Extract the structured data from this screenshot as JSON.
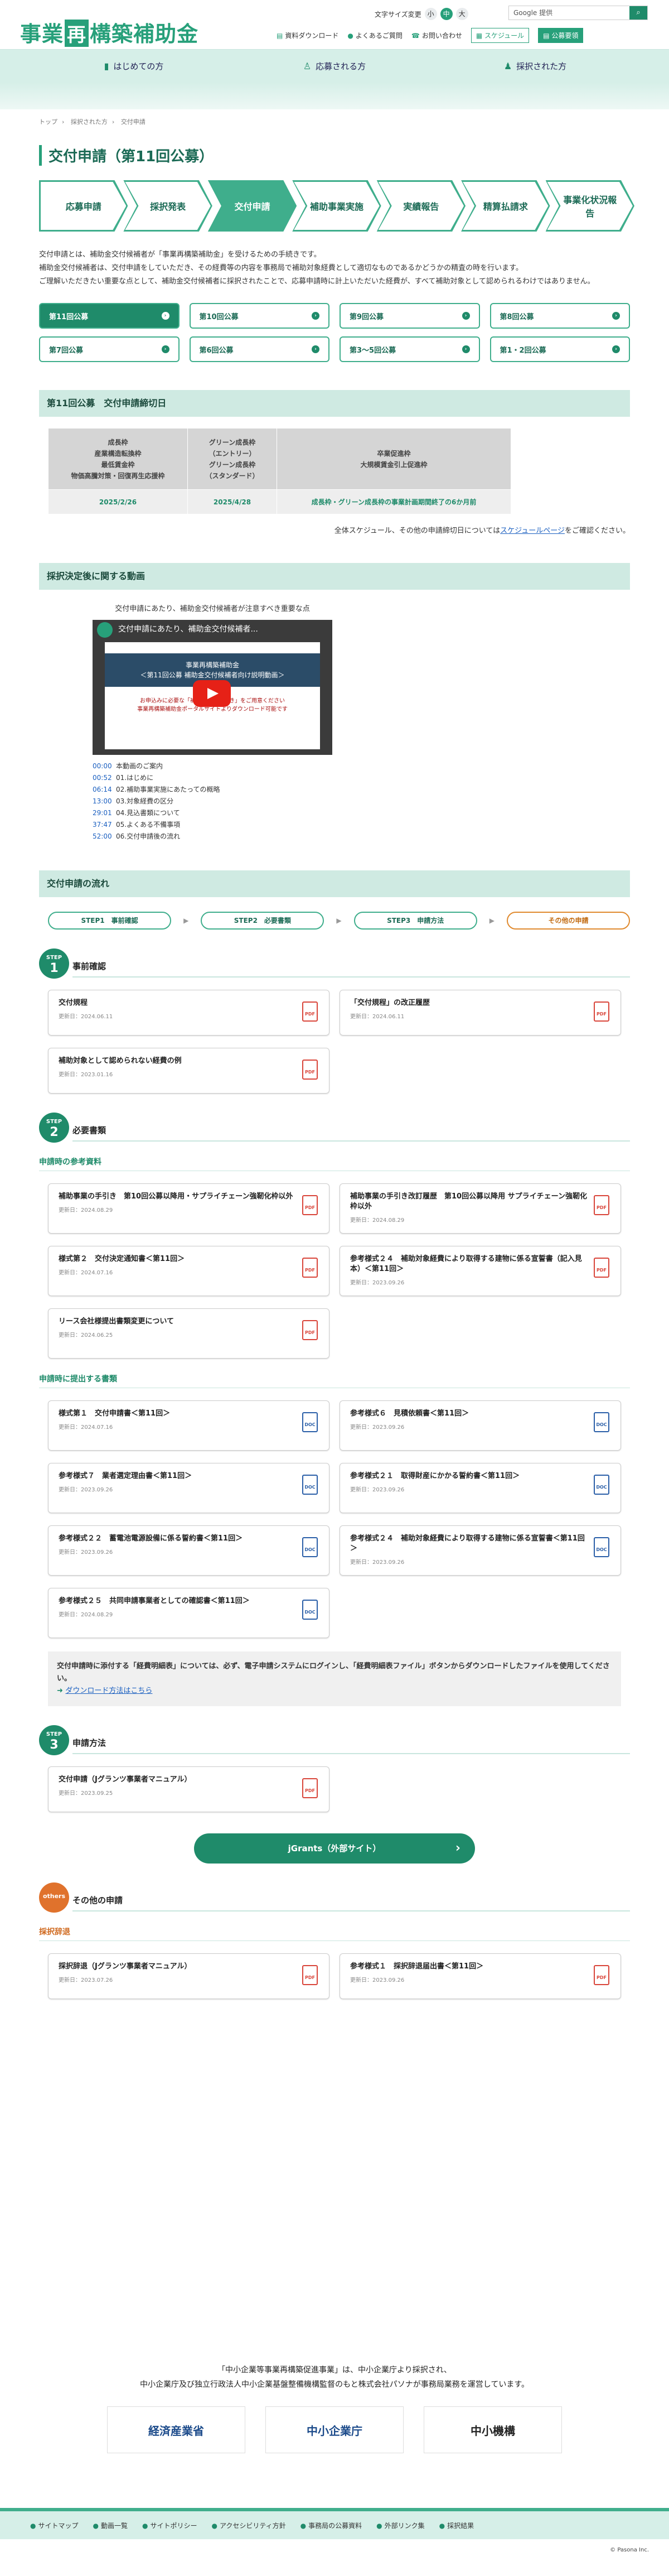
{
  "header": {
    "logo": {
      "pre": "事業",
      "mark": "再",
      "post": "構築補助金"
    },
    "font_size_label": "文字サイズ変更",
    "font_sizes": [
      "小",
      "中",
      "大"
    ],
    "search_placeholder": "Google 提供",
    "links": [
      "資料ダウンロード",
      "よくあるご質問",
      "お問い合わせ"
    ],
    "buttons": [
      "スケジュール",
      "公募要領"
    ]
  },
  "nav": [
    "はじめての方",
    "応募される方",
    "採択された方"
  ],
  "breadcrumb": [
    "トップ",
    "採択された方",
    "交付申請"
  ],
  "page_title": "交付申請（第11回公募）",
  "steps": [
    "応募申請",
    "採択発表",
    "交付申請",
    "補助事業実施",
    "実績報告",
    "精算払請求",
    "事業化状況報告"
  ],
  "intro": [
    "交付申請とは、補助金交付候補者が「事業再構築補助金」を受けるための手続きです。",
    "補助金交付候補者は、交付申請をしていただき、その経費等の内容を事務局で補助対象経費として適切なものであるかどうかの精査の時を行います。",
    "ご理解いただきたい重要な点として、補助金交付候補者に採択されたことで、応募申請時に計上いただいた経費が、すべて補助対象として認められるわけではありません。"
  ],
  "rounds": [
    "第11回公募",
    "第10回公募",
    "第9回公募",
    "第8回公募",
    "第7回公募",
    "第6回公募",
    "第3～5回公募",
    "第1・2回公募"
  ],
  "deadline": {
    "section": "第11回公募　交付申請締切日",
    "cols": [
      {
        "head": "成長枠\n産業構造転換枠\n最低賃金枠\n物価高騰対策・回復再生応援枠",
        "value": "2025/2/26"
      },
      {
        "head": "グリーン成長枠\n（エントリー）\nグリーン成長枠\n（スタンダード）",
        "value": "2025/4/28"
      },
      {
        "head": "卒業促進枠\n大規模賃金引上促進枠",
        "value": "成長枠・グリーン成長枠の事業計画期間終了の6か月前"
      }
    ],
    "schedule_pre": "全体スケジュール、その他の申請締切日については",
    "schedule_link": "スケジュールページ",
    "schedule_post": "をご確認ください。"
  },
  "video": {
    "section": "採択決定後に関する動画",
    "caption": "交付申請にあたり、補助金交付候補者が注意すべき重要な点",
    "player_title": "交付申請にあたり、補助金交付候補者...",
    "slide_title": "事業再構築補助金\n＜第11回公募 補助金交付候補者向け説明動画＞",
    "slide_note": "お申込みに必要な「補助事業の手引き」をご用意ください\n事業再構築補助金ポータルサイトよりダウンロード可能です",
    "chapters": [
      {
        "t": "00:00",
        "l": "本動画のご案内"
      },
      {
        "t": "00:52",
        "l": "01.はじめに"
      },
      {
        "t": "06:14",
        "l": "02.補助事業実施にあたっての概略"
      },
      {
        "t": "13:00",
        "l": "03.対象経費の区分"
      },
      {
        "t": "29:01",
        "l": "04.見込書類について"
      },
      {
        "t": "37:47",
        "l": "05.よくある不備事項"
      },
      {
        "t": "52:00",
        "l": "06.交付申請後の流れ"
      }
    ]
  },
  "flow": {
    "section": "交付申請の流れ",
    "tabs": [
      "STEP1　事前確認",
      "STEP2　必要書類",
      "STEP3　申請方法",
      "その他の申請"
    ]
  },
  "step1": {
    "label": "STEP",
    "num": "1",
    "title": "事前確認",
    "cards": [
      {
        "t": "交付規程",
        "d": "更新日：2024.06.11",
        "f": "PDF"
      },
      {
        "t": "「交付規程」の改正履歴",
        "d": "更新日：2024.06.11",
        "f": "PDF"
      },
      {
        "t": "補助対象として認められない経費の例",
        "d": "更新日：2023.01.16",
        "f": "PDF"
      }
    ]
  },
  "step2": {
    "label": "STEP",
    "num": "2",
    "title": "必要書類",
    "ref_title": "申請時の参考資料",
    "ref_cards": [
      {
        "t": "補助事業の手引き　第10回公募以降用・サプライチェーン強靭化枠以外",
        "d": "更新日：2024.08.29",
        "f": "PDF"
      },
      {
        "t": "補助事業の手引き改訂履歴　第10回公募以降用 サプライチェーン強靭化枠以外",
        "d": "更新日：2024.08.29",
        "f": "PDF"
      },
      {
        "t": "様式第２　交付決定通知書＜第11回＞",
        "d": "更新日：2024.07.16",
        "f": "PDF"
      },
      {
        "t": "参考様式２４　補助対象経費により取得する建物に係る宣誓書（記入見本）＜第11回＞",
        "d": "更新日：2023.09.26",
        "f": "PDF"
      },
      {
        "t": "リース会社様提出書類変更について",
        "d": "更新日：2024.06.25",
        "f": "PDF"
      }
    ],
    "sub_title": "申請時に提出する書類",
    "sub_cards": [
      {
        "t": "様式第１　交付申請書＜第11回＞",
        "d": "更新日：2024.07.16",
        "f": "DOC"
      },
      {
        "t": "参考様式６　見積依頼書＜第11回＞",
        "d": "更新日：2023.09.26",
        "f": "DOC"
      },
      {
        "t": "参考様式７　業者選定理由書＜第11回＞",
        "d": "更新日：2023.09.26",
        "f": "DOC"
      },
      {
        "t": "参考様式２１　取得財産にかかる誓約書＜第11回＞",
        "d": "更新日：2023.09.26",
        "f": "DOC"
      },
      {
        "t": "参考様式２２　蓄電池電源設備に係る誓約書＜第11回＞",
        "d": "更新日：2023.09.26",
        "f": "DOC"
      },
      {
        "t": "参考様式２４　補助対象経費により取得する建物に係る宣誓書＜第11回＞",
        "d": "更新日：2023.09.26",
        "f": "DOC"
      },
      {
        "t": "参考様式２５　共同申請事業者としての確認書＜第11回＞",
        "d": "更新日：2024.08.29",
        "f": "DOC"
      }
    ],
    "note": "交付申請時に添付する「経費明細表」については、必ず、電子申請システムにログインし、「経費明細表ファイル」ボタンからダウンロードしたファイルを使用してください。",
    "note_link": "ダウンロード方法はこちら"
  },
  "step3": {
    "label": "STEP",
    "num": "3",
    "title": "申請方法",
    "cards": [
      {
        "t": "交付申請（Jグランツ事業者マニュアル）",
        "d": "更新日：2023.09.25",
        "f": "PDF"
      }
    ],
    "button": "jGrants（外部サイト）"
  },
  "others": {
    "label": "others",
    "title": "その他の申請",
    "sub_title": "採択辞退",
    "cards": [
      {
        "t": "採択辞退（Jグランツ事業者マニュアル）",
        "d": "更新日：2023.07.26",
        "f": "PDF"
      },
      {
        "t": "参考様式１　採択辞退届出書＜第11回＞",
        "d": "更新日：2023.09.26",
        "f": "PDF"
      }
    ]
  },
  "footer": {
    "note1": "「中小企業等事業再構築促進事業」は、中小企業庁より採択され、",
    "note2": "中小企業庁及び独立行政法人中小企業基盤整備機構監督のもと株式会社パソナが事務局業務を運営しています。",
    "logos": [
      "経済産業省",
      "中小企業庁",
      "中小機構"
    ],
    "links": [
      "サイトマップ",
      "動画一覧",
      "サイトポリシー",
      "アクセシビリティ方針",
      "事務局の公募資料",
      "外部リンク集",
      "採択結果"
    ],
    "copyright": "© Pasona Inc."
  }
}
